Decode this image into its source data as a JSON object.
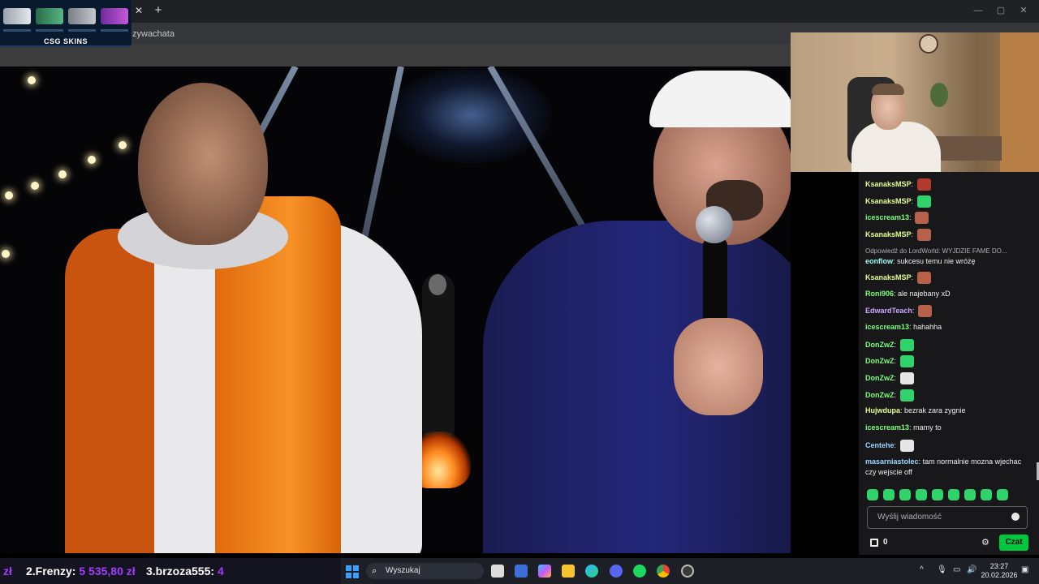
{
  "browser": {
    "address_partial": "zywachata",
    "close_tab": "✕",
    "new_tab": "+",
    "window_controls": [
      "—",
      "▢",
      "✕"
    ]
  },
  "banner": {
    "brand": "CSG SKINS"
  },
  "chat": {
    "messages": [
      {
        "user": "KsanaksMSP",
        "user_color": "#e3ff8a",
        "text": "",
        "emote": "red-face-emote"
      },
      {
        "user": "KsanaksMSP",
        "user_color": "#e3ff8a",
        "text": "",
        "emote": "green-emote"
      },
      {
        "user": "icescream13",
        "user_color": "#7dff7d",
        "text": "",
        "emote": "face-emote"
      },
      {
        "user": "KsanaksMSP",
        "user_color": "#e3ff8a",
        "text": "",
        "emote": "face-emote"
      },
      {
        "reply_to": "Odpowiedź do LordWorld: WYJDZIE FAME DO...",
        "user": "eonflow",
        "user_color": "#9bfff0",
        "text": "sukcesu temu nie wróżę"
      },
      {
        "user": "KsanaksMSP",
        "user_color": "#e3ff8a",
        "text": "",
        "emote": "face-emote"
      },
      {
        "user": "Roni906",
        "user_color": "#7dff7d",
        "text": "ale najebany xD"
      },
      {
        "user": "EdwardTeach",
        "user_color": "#c9a6ff",
        "text": "",
        "emote": "face-emote"
      },
      {
        "user": "icescream13",
        "user_color": "#7dff7d",
        "text": "hahahha"
      },
      {
        "user": "DonZwZ",
        "user_color": "#7dff7d",
        "text": "",
        "emote": "green-emote"
      },
      {
        "user": "DonZwZ",
        "user_color": "#7dff7d",
        "text": "",
        "emote": "green-emote"
      },
      {
        "user": "DonZwZ",
        "user_color": "#7dff7d",
        "text": "",
        "emote": "skull-emote"
      },
      {
        "user": "DonZwZ",
        "user_color": "#7dff7d",
        "text": "",
        "emote": "green-emote"
      },
      {
        "user": "Hujwdupa",
        "user_color": "#e3ff8a",
        "text": "bezrak zara zygnie"
      },
      {
        "user": "icescream13",
        "user_color": "#7dff7d",
        "text": "mamy to"
      },
      {
        "user": "Centehe",
        "user_color": "#9bd4ff",
        "text": "",
        "emote": "skull-emote"
      },
      {
        "user": "masarniastolec",
        "user_color": "#9bd4ff",
        "text": "tam normalnie mozna wjechac",
        "text2": "czy wejscie off"
      }
    ],
    "input_placeholder": "Wyślij wiadomość",
    "points": "0",
    "send_label": "Czat",
    "gear": "⚙"
  },
  "ticker": {
    "items": [
      {
        "label": "zł",
        "amount": ""
      },
      {
        "label": "2.Frenzy:",
        "amount": "5 535,80 zł"
      },
      {
        "label": "3.brzoza555:",
        "amount": "4"
      }
    ]
  },
  "taskbar": {
    "search_placeholder": "Wyszukaj",
    "time": "23:27",
    "date": "20.02.2026",
    "tray_up": "^"
  },
  "colors": {
    "chat_bg": "#18181b",
    "send_button": "#00c83c",
    "ticker_amount": "#a43cff",
    "accent_blue": "#3aa0ff"
  }
}
